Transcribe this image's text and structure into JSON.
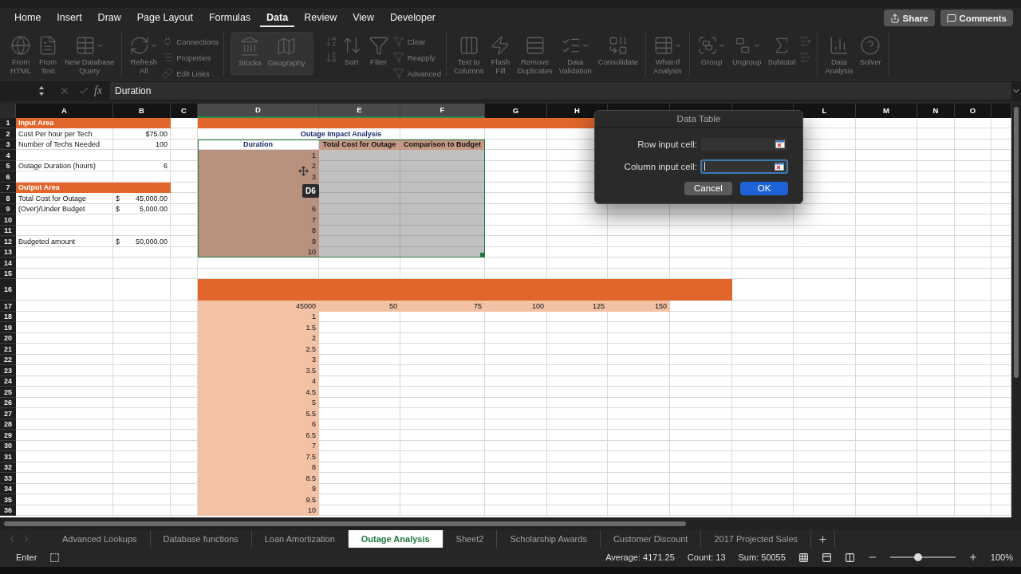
{
  "menu_tabs": [
    {
      "label": "Home",
      "selected": false
    },
    {
      "label": "Insert",
      "selected": false
    },
    {
      "label": "Draw",
      "selected": false
    },
    {
      "label": "Page Layout",
      "selected": false
    },
    {
      "label": "Formulas",
      "selected": false
    },
    {
      "label": "Data",
      "selected": true
    },
    {
      "label": "Review",
      "selected": false
    },
    {
      "label": "View",
      "selected": false
    },
    {
      "label": "Developer",
      "selected": false
    }
  ],
  "share_button": {
    "label": "Share"
  },
  "comments_button": {
    "label": "Comments"
  },
  "ribbon": {
    "groups": [
      {
        "kind": "normal",
        "items": [
          {
            "kind": "large",
            "label": "From\nHTML"
          },
          {
            "kind": "large",
            "label": "From\nText"
          },
          {
            "kind": "large",
            "label": "New Database\nQuery",
            "dropdown": true
          }
        ]
      },
      {
        "kind": "normal",
        "items": [
          {
            "kind": "large",
            "label": "Refresh\nAll",
            "dropdown": true
          },
          {
            "kind": "small",
            "label": "Connections"
          },
          {
            "kind": "small",
            "label": "Properties"
          },
          {
            "kind": "small",
            "label": "Edit Links"
          }
        ]
      },
      {
        "kind": "gallery",
        "items": [
          {
            "kind": "large",
            "label": "Stocks"
          },
          {
            "kind": "large",
            "label": "Geography"
          }
        ]
      },
      {
        "kind": "normal",
        "items": [
          {
            "kind": "icon"
          },
          {
            "kind": "icon"
          },
          {
            "kind": "large",
            "label": "Sort"
          },
          {
            "kind": "large",
            "label": "Filter"
          },
          {
            "kind": "small",
            "label": "Clear"
          },
          {
            "kind": "small",
            "label": "Reapply"
          },
          {
            "kind": "small",
            "label": "Advanced"
          }
        ]
      },
      {
        "kind": "normal",
        "items": [
          {
            "kind": "large",
            "label": "Text to\nColumns"
          },
          {
            "kind": "large",
            "label": "Flash\nFill"
          },
          {
            "kind": "large",
            "label": "Remove\nDuplicates"
          },
          {
            "kind": "large",
            "label": "Data\nValidation",
            "dropdown": true
          },
          {
            "kind": "large",
            "label": "Consolidate"
          }
        ]
      },
      {
        "kind": "normal",
        "items": [
          {
            "kind": "large",
            "label": "What-If\nAnalysis",
            "dropdown": true
          }
        ]
      },
      {
        "kind": "normal",
        "items": [
          {
            "kind": "large",
            "label": "Group",
            "dropdown": true
          },
          {
            "kind": "large",
            "label": "Ungroup",
            "dropdown": true
          },
          {
            "kind": "large",
            "label": "Subtotal"
          },
          {
            "kind": "icon"
          },
          {
            "kind": "icon"
          }
        ]
      },
      {
        "kind": "normal",
        "items": [
          {
            "kind": "large",
            "label": "Data\nAnalysis"
          },
          {
            "kind": "large",
            "label": "Solver"
          }
        ]
      }
    ]
  },
  "formula_bar": {
    "fx": "fx",
    "value": "Duration"
  },
  "columns": [
    {
      "label": "A",
      "selected": false
    },
    {
      "label": "B",
      "selected": false
    },
    {
      "label": "C",
      "selected": false
    },
    {
      "label": "D",
      "selected": true
    },
    {
      "label": "E",
      "selected": true
    },
    {
      "label": "F",
      "selected": true
    },
    {
      "label": "G",
      "selected": false
    },
    {
      "label": "H",
      "selected": false
    },
    {
      "selected": false
    },
    {
      "selected": false
    },
    {
      "selected": false
    },
    {
      "label": "L",
      "selected": false
    },
    {
      "label": "M",
      "selected": false
    },
    {
      "label": "N",
      "selected": false
    },
    {
      "label": "O",
      "selected": false
    },
    {
      "selected": false
    }
  ],
  "rows": [
    {
      "number": "1",
      "kind": "normal",
      "cells": [
        {
          "kind": "section",
          "text": "Input Area"
        },
        {
          "kind": "section"
        },
        null,
        {
          "kind": "band"
        },
        {
          "kind": "band"
        },
        {
          "kind": "band"
        },
        {
          "kind": "band"
        },
        {
          "kind": "band"
        },
        null,
        null,
        null,
        null,
        null,
        null,
        null,
        null
      ]
    },
    {
      "number": "2",
      "kind": "normal",
      "cells": [
        {
          "kind": "text",
          "text": "Cost Per hour per Tech"
        },
        {
          "kind": "number",
          "text": "$75.00"
        },
        null,
        {
          "kind": "title",
          "text": "Outage Impact Analysis"
        },
        null,
        null,
        null,
        null,
        null,
        null,
        null,
        null,
        null,
        null,
        null,
        null
      ]
    },
    {
      "number": "3",
      "kind": "normal",
      "cells": [
        {
          "kind": "text",
          "text": "Number of Techs Needed"
        },
        {
          "kind": "number",
          "text": "100"
        },
        null,
        {
          "kind": "colhead",
          "text": "Duration"
        },
        {
          "kind": "head",
          "text": "Total Cost for Outage"
        },
        {
          "kind": "head",
          "text": "Comparison to Budget"
        },
        null,
        null,
        null,
        null,
        null,
        null,
        null,
        null,
        null,
        null
      ]
    },
    {
      "number": "4",
      "kind": "normal",
      "cells": [
        null,
        null,
        null,
        {
          "kind": "dur",
          "text": "1"
        },
        {
          "kind": "shade"
        },
        {
          "kind": "shade"
        },
        null,
        null,
        null,
        null,
        null,
        null,
        null,
        null,
        null,
        null
      ]
    },
    {
      "number": "5",
      "kind": "normal",
      "cells": [
        {
          "kind": "text",
          "text": "Outage Duration (hours)"
        },
        {
          "kind": "number",
          "text": "6"
        },
        null,
        {
          "kind": "dur",
          "text": "2"
        },
        {
          "kind": "shade"
        },
        {
          "kind": "shade"
        },
        null,
        null,
        null,
        null,
        null,
        null,
        null,
        null,
        null,
        null
      ]
    },
    {
      "number": "6",
      "kind": "normal",
      "cells": [
        null,
        null,
        null,
        {
          "kind": "dur",
          "text": "3"
        },
        {
          "kind": "shade"
        },
        {
          "kind": "shade"
        },
        null,
        null,
        null,
        null,
        null,
        null,
        null,
        null,
        null,
        null
      ]
    },
    {
      "number": "7",
      "kind": "normal",
      "cells": [
        {
          "kind": "section",
          "text": "Output Area"
        },
        {
          "kind": "section"
        },
        null,
        {
          "kind": "dur"
        },
        {
          "kind": "shade"
        },
        {
          "kind": "shade"
        },
        null,
        null,
        null,
        null,
        null,
        null,
        null,
        null,
        null,
        null
      ]
    },
    {
      "number": "8",
      "kind": "normal",
      "cells": [
        {
          "kind": "text",
          "text": "Total Cost for Outage"
        },
        {
          "kind": "currency",
          "symbol": "$",
          "text": "45,000.00"
        },
        null,
        {
          "kind": "dur"
        },
        {
          "kind": "shade"
        },
        {
          "kind": "shade"
        },
        null,
        null,
        null,
        null,
        null,
        null,
        null,
        null,
        null,
        null
      ]
    },
    {
      "number": "9",
      "kind": "normal",
      "cells": [
        {
          "kind": "text",
          "text": "(Over)/Under Budget"
        },
        {
          "kind": "currency",
          "symbol": "$",
          "text": "5,000.00"
        },
        null,
        {
          "kind": "dur",
          "text": "6"
        },
        {
          "kind": "shade"
        },
        {
          "kind": "shade"
        },
        null,
        null,
        null,
        null,
        null,
        null,
        null,
        null,
        null,
        null
      ]
    },
    {
      "number": "10",
      "kind": "normal",
      "cells": [
        null,
        null,
        null,
        {
          "kind": "dur",
          "text": "7"
        },
        {
          "kind": "shade"
        },
        {
          "kind": "shade"
        },
        null,
        null,
        null,
        null,
        null,
        null,
        null,
        null,
        null,
        null
      ]
    },
    {
      "number": "11",
      "kind": "normal",
      "cells": [
        null,
        null,
        null,
        {
          "kind": "dur",
          "text": "8"
        },
        {
          "kind": "shade"
        },
        {
          "kind": "shade"
        },
        null,
        null,
        null,
        null,
        null,
        null,
        null,
        null,
        null,
        null
      ]
    },
    {
      "number": "12",
      "kind": "normal",
      "cells": [
        {
          "kind": "text",
          "text": "Budgeted amount"
        },
        {
          "kind": "currency",
          "symbol": "$",
          "text": "50,000.00"
        },
        null,
        {
          "kind": "dur",
          "text": "9"
        },
        {
          "kind": "shade"
        },
        {
          "kind": "shade"
        },
        null,
        null,
        null,
        null,
        null,
        null,
        null,
        null,
        null,
        null
      ]
    },
    {
      "number": "13",
      "kind": "normal",
      "cells": [
        null,
        null,
        null,
        {
          "kind": "dur",
          "text": "10"
        },
        {
          "kind": "shade"
        },
        {
          "kind": "shade"
        },
        null,
        null,
        null,
        null,
        null,
        null,
        null,
        null,
        null,
        null
      ]
    },
    {
      "number": "14",
      "kind": "normal",
      "cells": []
    },
    {
      "number": "15",
      "kind": "normal",
      "cells": []
    },
    {
      "number": "16",
      "kind": "tall",
      "cells": [
        null,
        null,
        null,
        {
          "kind": "band"
        },
        {
          "kind": "band"
        },
        {
          "kind": "band"
        },
        {
          "kind": "band"
        },
        {
          "kind": "band"
        },
        {
          "kind": "band"
        },
        {
          "kind": "band"
        },
        null,
        null,
        null,
        null,
        null,
        null
      ]
    },
    {
      "number": "17",
      "kind": "normal",
      "cells": [
        null,
        null,
        null,
        {
          "kind": "light",
          "text": "45000"
        },
        {
          "kind": "light",
          "text": "50"
        },
        {
          "kind": "light",
          "text": "75"
        },
        {
          "kind": "light",
          "text": "100"
        },
        {
          "kind": "light",
          "text": "125"
        },
        {
          "kind": "light",
          "text": "150"
        },
        null,
        null,
        null,
        null,
        null,
        null,
        null
      ]
    },
    {
      "number": "18",
      "kind": "normal",
      "cells": [
        null,
        null,
        null,
        {
          "kind": "light",
          "text": "1"
        }
      ]
    },
    {
      "number": "19",
      "kind": "normal",
      "cells": [
        null,
        null,
        null,
        {
          "kind": "light",
          "text": "1.5"
        }
      ]
    },
    {
      "number": "20",
      "kind": "normal",
      "cells": [
        null,
        null,
        null,
        {
          "kind": "light",
          "text": "2"
        }
      ]
    },
    {
      "number": "21",
      "kind": "normal",
      "cells": [
        null,
        null,
        null,
        {
          "kind": "light",
          "text": "2.5"
        }
      ]
    },
    {
      "number": "22",
      "kind": "normal",
      "cells": [
        null,
        null,
        null,
        {
          "kind": "light",
          "text": "3"
        }
      ]
    },
    {
      "number": "23",
      "kind": "normal",
      "cells": [
        null,
        null,
        null,
        {
          "kind": "light",
          "text": "3.5"
        }
      ]
    },
    {
      "number": "24",
      "kind": "normal",
      "cells": [
        null,
        null,
        null,
        {
          "kind": "light",
          "text": "4"
        }
      ]
    },
    {
      "number": "25",
      "kind": "normal",
      "cells": [
        null,
        null,
        null,
        {
          "kind": "light",
          "text": "4.5"
        }
      ]
    },
    {
      "number": "26",
      "kind": "normal",
      "cells": [
        null,
        null,
        null,
        {
          "kind": "light",
          "text": "5"
        }
      ]
    },
    {
      "number": "27",
      "kind": "normal",
      "cells": [
        null,
        null,
        null,
        {
          "kind": "light",
          "text": "5.5"
        }
      ]
    },
    {
      "number": "28",
      "kind": "normal",
      "cells": [
        null,
        null,
        null,
        {
          "kind": "light",
          "text": "6"
        }
      ]
    },
    {
      "number": "29",
      "kind": "normal",
      "cells": [
        null,
        null,
        null,
        {
          "kind": "light",
          "text": "6.5"
        }
      ]
    },
    {
      "number": "30",
      "kind": "normal",
      "cells": [
        null,
        null,
        null,
        {
          "kind": "light",
          "text": "7"
        }
      ]
    },
    {
      "number": "31",
      "kind": "normal",
      "cells": [
        null,
        null,
        null,
        {
          "kind": "light",
          "text": "7.5"
        }
      ]
    },
    {
      "number": "32",
      "kind": "normal",
      "cells": [
        null,
        null,
        null,
        {
          "kind": "light",
          "text": "8"
        }
      ]
    },
    {
      "number": "33",
      "kind": "normal",
      "cells": [
        null,
        null,
        null,
        {
          "kind": "light",
          "text": "8.5"
        }
      ]
    },
    {
      "number": "34",
      "kind": "normal",
      "cells": [
        null,
        null,
        null,
        {
          "kind": "light",
          "text": "9"
        }
      ]
    },
    {
      "number": "35",
      "kind": "normal",
      "cells": [
        null,
        null,
        null,
        {
          "kind": "light",
          "text": "9.5"
        }
      ]
    },
    {
      "number": "36",
      "kind": "normal",
      "cells": [
        null,
        null,
        null,
        {
          "kind": "light",
          "text": "10"
        }
      ]
    }
  ],
  "cell_tooltip": "D6",
  "dialog": {
    "title": "Data Table",
    "fields": [
      {
        "label": "Row input cell:",
        "focused": false
      },
      {
        "label": "Column input cell:",
        "focused": true
      }
    ],
    "buttons": [
      {
        "label": "Cancel",
        "kind": "secondary"
      },
      {
        "label": "OK",
        "kind": "primary"
      }
    ]
  },
  "sheet_tabs": [
    {
      "label": "Advanced Lookups",
      "selected": false
    },
    {
      "label": "Database functions",
      "selected": false
    },
    {
      "label": "Loan Amortization",
      "selected": false
    },
    {
      "label": "Outage Analysis",
      "selected": true
    },
    {
      "label": "Sheet2",
      "selected": false
    },
    {
      "label": "Scholarship Awards",
      "selected": false
    },
    {
      "label": "Customer Discount",
      "selected": false
    },
    {
      "label": "2017 Projected Sales",
      "selected": false
    }
  ],
  "status_bar": {
    "mode": "Enter",
    "stats": [
      "Average: 4171.25",
      "Count: 13",
      "Sum: 50055"
    ],
    "zoom": {
      "level": 0.43,
      "reading": "100%"
    }
  }
}
